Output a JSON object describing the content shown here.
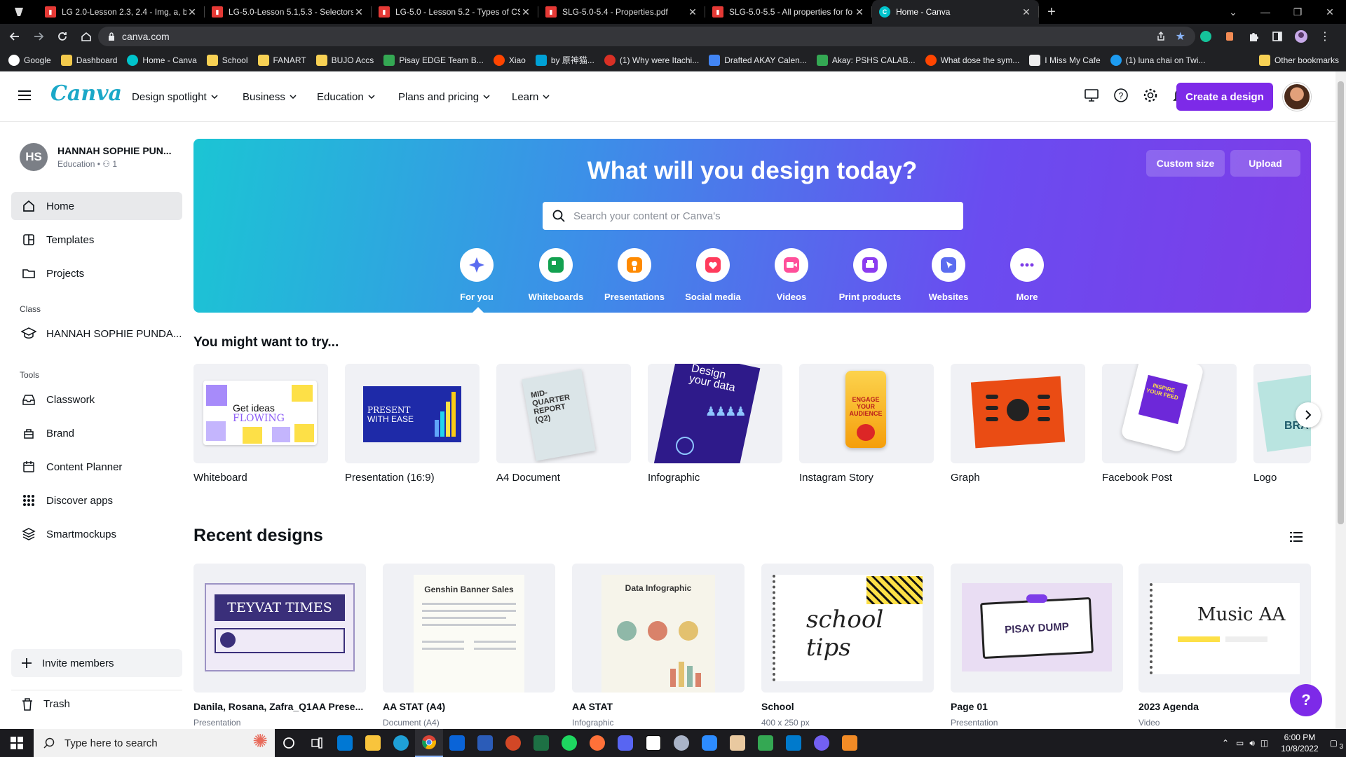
{
  "browser": {
    "tabs": [
      {
        "title": "LG 2.0-Lesson 2.3, 2.4 - Img, a, br",
        "favicon": "pdf-icon"
      },
      {
        "title": "LG-5.0-Lesson 5.1,5.3 - Selectors",
        "favicon": "pdf-icon"
      },
      {
        "title": "LG-5.0 - Lesson 5.2 - Types of CS",
        "favicon": "pdf-icon"
      },
      {
        "title": "SLG-5.0-5.4 - Properties.pdf",
        "favicon": "pdf-icon"
      },
      {
        "title": "SLG-5.0-5.5 - All properties for fo",
        "favicon": "pdf-icon"
      },
      {
        "title": "Home - Canva",
        "favicon": "canva-icon",
        "active": true
      }
    ],
    "url": "canva.com",
    "bookmarks": [
      {
        "label": "Google",
        "color": "#ffffff"
      },
      {
        "label": "Dashboard",
        "color": "#f2c94c"
      },
      {
        "label": "Home - Canva",
        "color": "#00c4cc"
      },
      {
        "label": "School",
        "color": "#f7d154"
      },
      {
        "label": "FANART",
        "color": "#f7d154"
      },
      {
        "label": "BUJO Accs",
        "color": "#f7d154"
      },
      {
        "label": "Pisay EDGE Team B...",
        "color": "#34a853"
      },
      {
        "label": "Xiao",
        "color": "#ff4500"
      },
      {
        "label": "by 原神猫...",
        "color": "#00a1d6"
      },
      {
        "label": "(1) Why were Itachi...",
        "color": "#d93025"
      },
      {
        "label": "Drafted AKAY Calen...",
        "color": "#4285f4"
      },
      {
        "label": "Akay: PSHS CALAB...",
        "color": "#34a853"
      },
      {
        "label": "What dose the sym...",
        "color": "#ff4500"
      },
      {
        "label": "I Miss My Cafe",
        "color": "#eeeeee"
      },
      {
        "label": "(1) luna chai on Twi...",
        "color": "#1d9bf0"
      }
    ],
    "other_bookmarks": "Other bookmarks"
  },
  "header": {
    "logo": "Canva",
    "menus": [
      "Design spotlight",
      "Business",
      "Education",
      "Plans and pricing",
      "Learn"
    ],
    "create_button": "Create a design"
  },
  "sidebar": {
    "profile_initials": "HS",
    "profile_name": "HANNAH SOPHIE PUN...",
    "profile_sub": "Education • ⚇ 1",
    "items": [
      {
        "label": "Home",
        "icon": "home-icon"
      },
      {
        "label": "Templates",
        "icon": "templates-icon"
      },
      {
        "label": "Projects",
        "icon": "folder-icon"
      }
    ],
    "class_heading": "Class",
    "class_item": "HANNAH SOPHIE PUNDA...",
    "tools_heading": "Tools",
    "tools": [
      {
        "label": "Classwork",
        "icon": "inbox-icon"
      },
      {
        "label": "Brand",
        "icon": "brand-icon"
      },
      {
        "label": "Content Planner",
        "icon": "calendar-icon"
      },
      {
        "label": "Discover apps",
        "icon": "apps-grid-icon"
      },
      {
        "label": "Smartmockups",
        "icon": "layers-icon"
      }
    ],
    "invite": "Invite members",
    "trash": "Trash"
  },
  "hero": {
    "title": "What will you design today?",
    "custom_size": "Custom size",
    "upload": "Upload",
    "search_placeholder": "Search your content or Canva's",
    "categories": [
      {
        "label": "For you",
        "color": "#5b6cf0",
        "icon": "sparkle-icon"
      },
      {
        "label": "Whiteboards",
        "color": "#12a150",
        "icon": "whiteboard-icon"
      },
      {
        "label": "Presentations",
        "color": "#ff8a00",
        "icon": "presentation-icon"
      },
      {
        "label": "Social media",
        "color": "#ff3b5c",
        "icon": "heart-icon"
      },
      {
        "label": "Videos",
        "color": "#ff4f9a",
        "icon": "video-icon"
      },
      {
        "label": "Print products",
        "color": "#8b3cf0",
        "icon": "print-icon"
      },
      {
        "label": "Websites",
        "color": "#5b6cf0",
        "icon": "cursor-icon"
      },
      {
        "label": "More",
        "color": "#7d3ce8",
        "icon": "more-icon"
      }
    ]
  },
  "try": {
    "title": "You might want to try...",
    "items": [
      "Whiteboard",
      "Presentation (16:9)",
      "A4 Document",
      "Infographic",
      "Instagram Story",
      "Graph",
      "Facebook Post",
      "Logo"
    ],
    "thumb_texts": {
      "whiteboard": "Get ideas",
      "whiteboard2": "FLOWING",
      "presentation": "PRESENT",
      "presentation2": "WITH EASE",
      "a4": "MID-QUARTER REPORT (Q2)",
      "infographic": "Design your data",
      "story": "ENGAGE YOUR AUDIENCE",
      "facebook": "INSPIRE YOUR FEED",
      "logo": "BRA"
    }
  },
  "recent": {
    "title": "Recent designs",
    "items": [
      {
        "title": "Danila, Rosana, Zafra_Q1AA Prese...",
        "sub": "Presentation",
        "thumb": "TEYVAT TIMES"
      },
      {
        "title": "AA STAT (A4)",
        "sub": "Document (A4)",
        "thumb": "Genshin Banner Sales"
      },
      {
        "title": "AA STAT",
        "sub": "Infographic",
        "thumb": "Data Infographic"
      },
      {
        "title": "School",
        "sub": "400 x 250 px",
        "thumb": "school tips"
      },
      {
        "title": "Page 01",
        "sub": "Presentation",
        "thumb": "PISAY DUMP"
      },
      {
        "title": "2023 Agenda",
        "sub": "Video",
        "thumb": "Music AA"
      }
    ]
  },
  "taskbar": {
    "search_placeholder": "Type here to search",
    "time": "6:00 PM",
    "date": "10/8/2022",
    "notifications": "3"
  },
  "help": "?"
}
